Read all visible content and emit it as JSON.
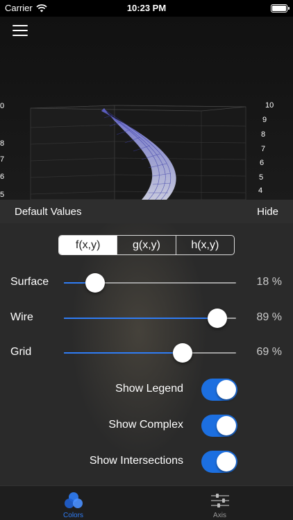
{
  "status": {
    "carrier": "Carrier",
    "time": "10:23 PM"
  },
  "plot": {
    "left_axis_ticks": [
      "0",
      "8",
      "7",
      "6",
      "5"
    ],
    "right_axis_ticks": [
      "10",
      "9",
      "8",
      "7",
      "6",
      "5",
      "4"
    ]
  },
  "panel": {
    "title": "Default Values",
    "hide_label": "Hide"
  },
  "functions": {
    "options": [
      "f(x,y)",
      "g(x,y)",
      "h(x,y)"
    ],
    "selected": 0
  },
  "sliders": [
    {
      "label": "Surface",
      "value_text": "18 %",
      "fraction": 0.18
    },
    {
      "label": "Wire",
      "value_text": "89 %",
      "fraction": 0.89
    },
    {
      "label": "Grid",
      "value_text": "69 %",
      "fraction": 0.69
    }
  ],
  "toggles": [
    {
      "label": "Show Legend",
      "on": true
    },
    {
      "label": "Show Complex",
      "on": true
    },
    {
      "label": "Show Intersections",
      "on": true
    }
  ],
  "tabs": [
    {
      "label": "Colors",
      "icon": "colors-icon",
      "active": true
    },
    {
      "label": "Axis",
      "icon": "sliders-icon",
      "active": false
    }
  ],
  "colors": {
    "accent": "#2f7df6",
    "toggle_on": "#1c6fe0"
  }
}
